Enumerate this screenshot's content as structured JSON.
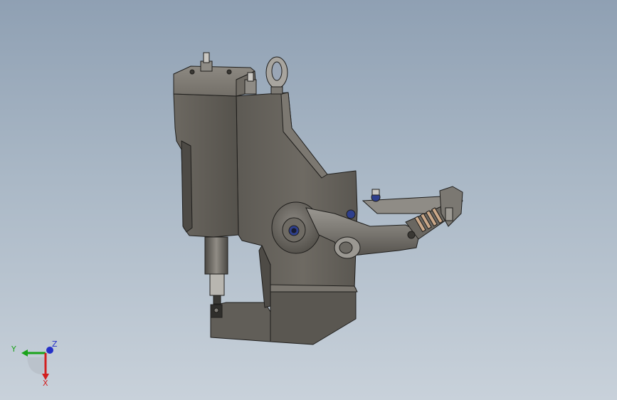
{
  "viewport": {
    "background_top": "#8fa0b3",
    "background_bottom": "#c8d1da",
    "model_color": "#6a665f",
    "accent_blue": "#2e3f8c"
  },
  "triad": {
    "x_label": "X",
    "y_label": "Y",
    "z_label": "Z",
    "x_color": "#d21f1f",
    "y_color": "#1aa31a",
    "z_color": "#2430c8"
  }
}
